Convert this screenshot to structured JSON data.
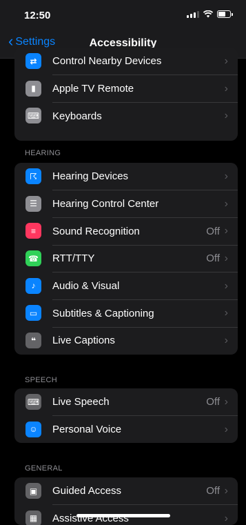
{
  "status": {
    "time": "12:50"
  },
  "nav": {
    "back_label": "Settings",
    "title": "Accessibility"
  },
  "groups": [
    {
      "header": "",
      "rows": [
        {
          "label": "Control Nearby Devices",
          "value": "",
          "icon": "nearby-devices-icon",
          "color": "#0a84ff"
        },
        {
          "label": "Apple TV Remote",
          "value": "",
          "icon": "tv-remote-icon",
          "color": "#8e8e93"
        },
        {
          "label": "Keyboards",
          "value": "",
          "icon": "keyboard-icon",
          "color": "#8e8e93"
        }
      ]
    },
    {
      "header": "HEARING",
      "rows": [
        {
          "label": "Hearing Devices",
          "value": "",
          "icon": "ear-icon",
          "color": "#0a84ff"
        },
        {
          "label": "Hearing Control Center",
          "value": "",
          "icon": "toggles-icon",
          "color": "#8e8e93"
        },
        {
          "label": "Sound Recognition",
          "value": "Off",
          "icon": "waveform-search-icon",
          "color": "#ff375f"
        },
        {
          "label": "RTT/TTY",
          "value": "Off",
          "icon": "tty-icon",
          "color": "#30d158"
        },
        {
          "label": "Audio & Visual",
          "value": "",
          "icon": "speaker-eye-icon",
          "color": "#0a84ff"
        },
        {
          "label": "Subtitles & Captioning",
          "value": "",
          "icon": "captions-icon",
          "color": "#0a84ff"
        },
        {
          "label": "Live Captions",
          "value": "",
          "icon": "live-captions-icon",
          "color": "#636366"
        }
      ]
    },
    {
      "header": "SPEECH",
      "rows": [
        {
          "label": "Live Speech",
          "value": "Off",
          "icon": "keyboard-speech-icon",
          "color": "#636366"
        },
        {
          "label": "Personal Voice",
          "value": "",
          "icon": "person-voice-icon",
          "color": "#0a84ff"
        }
      ]
    },
    {
      "header": "GENERAL",
      "rows": [
        {
          "label": "Guided Access",
          "value": "Off",
          "icon": "lock-frame-icon",
          "color": "#636366"
        },
        {
          "label": "Assistive Access",
          "value": "",
          "icon": "assistive-access-icon",
          "color": "#636366"
        }
      ]
    }
  ]
}
